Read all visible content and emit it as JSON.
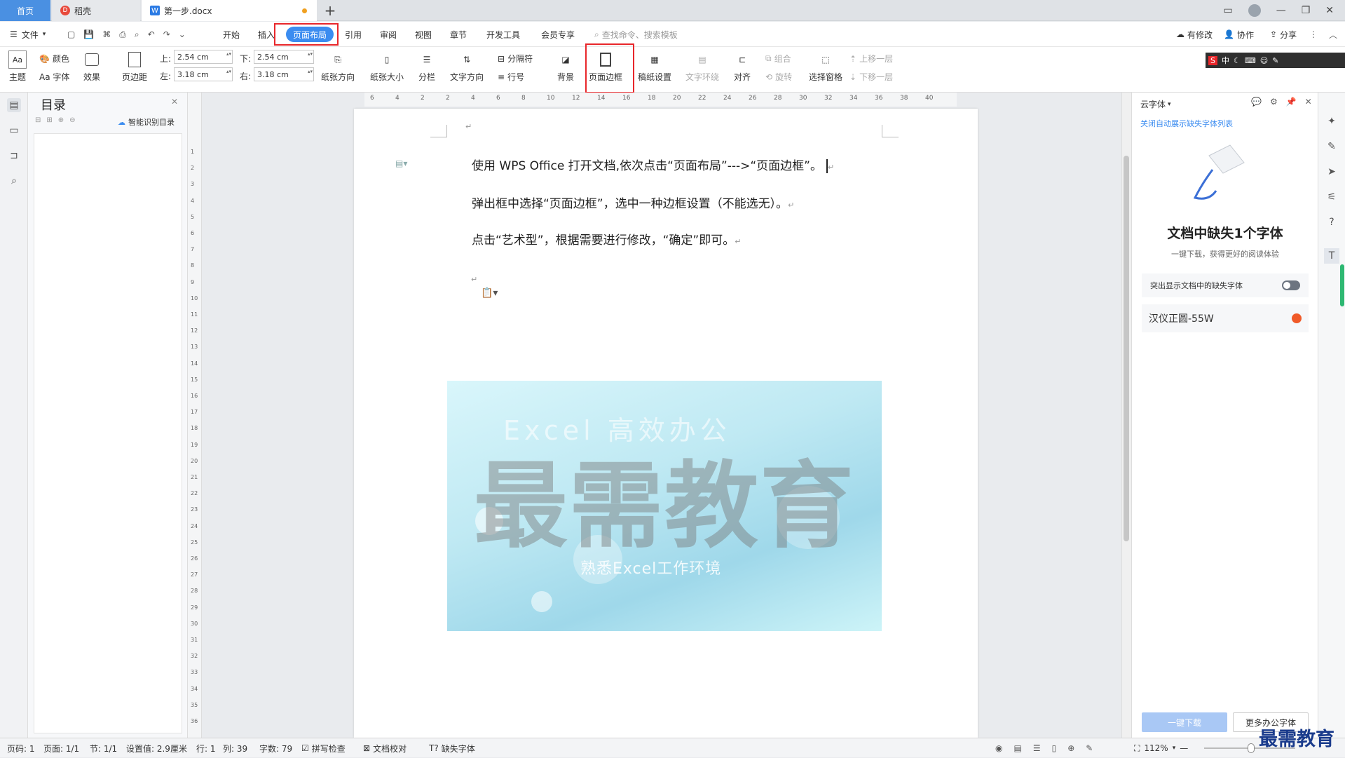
{
  "tabs": {
    "home": "首页",
    "daoke": "稻壳",
    "doc": "第一步.docx",
    "add": "+"
  },
  "menu": {
    "file": "文件",
    "items": [
      "开始",
      "插入",
      "页面布局",
      "引用",
      "审阅",
      "视图",
      "章节",
      "开发工具",
      "会员专享"
    ],
    "search_placeholder": "查找命令、搜索模板",
    "right": {
      "modified": "有修改",
      "collab": "协作",
      "share": "分享"
    }
  },
  "ribbon": {
    "theme": "主题",
    "colors": "颜色",
    "fonts": "Aa 字体",
    "effects": "效果",
    "margins": "页边距",
    "top_label": "上:",
    "top_val": "2.54 cm",
    "bottom_label": "下:",
    "bottom_val": "2.54 cm",
    "left_label": "左:",
    "left_val": "3.18 cm",
    "right_label": "右:",
    "right_val": "3.18 cm",
    "orientation": "纸张方向",
    "size": "纸张大小",
    "columns": "分栏",
    "text_dir": "文字方向",
    "separator": "分隔符",
    "line_no": "行号",
    "background": "背景",
    "page_border": "页面边框",
    "manuscript": "稿纸设置",
    "wrap": "文字环绕",
    "align": "对齐",
    "group": "组合",
    "rotate": "旋转",
    "select_pane": "选择窗格",
    "bring_forward": "上移一层",
    "send_backward": "下移一层"
  },
  "toc": {
    "title": "目录",
    "smart": "智能识别目录"
  },
  "ruler": {
    "h_ticks": [
      "6",
      "4",
      "2",
      "2",
      "4",
      "6",
      "8",
      "10",
      "12",
      "14",
      "16",
      "18",
      "20",
      "22",
      "24",
      "26",
      "28",
      "30",
      "32",
      "34",
      "36",
      "38",
      "40"
    ],
    "v_ticks": [
      "1",
      "2",
      "3",
      "4",
      "5",
      "6",
      "7",
      "8",
      "9",
      "10",
      "11",
      "12",
      "13",
      "14",
      "15",
      "16",
      "17",
      "18",
      "19",
      "20",
      "21",
      "22",
      "23",
      "24",
      "25",
      "26",
      "27",
      "28",
      "29",
      "30",
      "31",
      "32",
      "33",
      "34",
      "35",
      "36"
    ]
  },
  "document": {
    "p1": "使用 WPS Office 打开文档,依次点击“页面布局”--->“页面边框”。",
    "p2": "弹出框中选择“页面边框”，选中一种边框设置（不能选无）。",
    "p3": "点击“艺术型”，根据需要进行修改，“确定”即可。",
    "image": {
      "line1": "Excel  高效办公",
      "line2": "熟悉Excel工作环境",
      "watermark": "最需教育"
    }
  },
  "cloudfont": {
    "title": "云字体",
    "link": "关闭自动展示缺失字体列表",
    "heading": "文档中缺失1个字体",
    "sub": "一键下载，获得更好的阅读体验",
    "toggle_label": "突出显示文档中的缺失字体",
    "font_name": "汉仪正圆-55W",
    "download": "一键下载",
    "more": "更多办公字体"
  },
  "status": {
    "page": "页码: 1",
    "pages": "页面: 1/1",
    "section": "节: 1/1",
    "setting": "设置值: 2.9厘米",
    "row": "行: 1",
    "col": "列: 39",
    "words": "字数: 79",
    "spell": "拼写检查",
    "proof": "文档校对",
    "missing": "缺失字体",
    "zoom": "112%"
  },
  "brand": {
    "logo_text": "最需教育"
  },
  "colors": {
    "accent": "#3b8cf0",
    "highlight": "#e8262a"
  }
}
